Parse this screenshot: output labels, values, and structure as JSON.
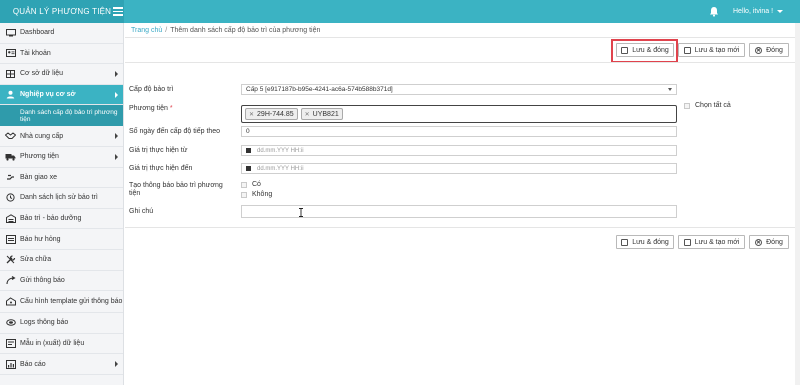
{
  "app": {
    "title": "QUẢN LÝ PHƯƠNG TIỆN"
  },
  "header": {
    "user_label": "Hello, itvina !"
  },
  "sidebar": {
    "items": [
      {
        "label": "Dashboard",
        "icon": "monitor-icon",
        "arrow": false
      },
      {
        "label": "Tài khoản",
        "icon": "user-card-icon",
        "arrow": false
      },
      {
        "label": "Cơ sở dữ liệu",
        "icon": "table-icon",
        "arrow": true
      },
      {
        "label": "Nghiệp vụ cơ sở",
        "icon": "user-icon",
        "arrow": true,
        "active": true
      },
      {
        "label": "Danh sách cấp độ bảo trì phương tiện",
        "sub": true
      },
      {
        "label": "Nhà cung cấp",
        "icon": "handshake-icon",
        "arrow": true
      },
      {
        "label": "Phương tiện",
        "icon": "truck-icon",
        "arrow": true
      },
      {
        "label": "Bàn giao xe",
        "icon": "handover-icon",
        "arrow": false
      },
      {
        "label": "Danh sách lịch sử bảo trì",
        "icon": "history-icon",
        "arrow": false
      },
      {
        "label": "Bảo trì - bảo dưỡng",
        "icon": "garage-icon",
        "arrow": false
      },
      {
        "label": "Báo hư hỏng",
        "icon": "warning-car-icon",
        "arrow": false
      },
      {
        "label": "Sửa chữa",
        "icon": "wrench-icon",
        "arrow": false
      },
      {
        "label": "Gửi thông báo",
        "icon": "send-icon",
        "arrow": false
      },
      {
        "label": "Cấu hình template gửi thông báo",
        "icon": "template-icon",
        "arrow": false,
        "two": true
      },
      {
        "label": "Logs thông báo",
        "icon": "logs-icon",
        "arrow": false
      },
      {
        "label": "Mẫu in (xuất) dữ liệu",
        "icon": "print-icon",
        "arrow": false
      },
      {
        "label": "Báo cáo",
        "icon": "report-icon",
        "arrow": true
      }
    ]
  },
  "breadcrumb": {
    "home": "Trang chủ",
    "separator": "/",
    "current": "Thêm danh sách cấp độ bảo trì của phương tiện"
  },
  "buttons": {
    "save_close": "Lưu & đóng",
    "save_new": "Lưu & tạo mới",
    "close": "Đóng"
  },
  "form": {
    "maintenance_level": {
      "label": "Cấp độ bảo trì",
      "value": "Cấp 5 [e917187b-b95e-4241-ac6a-574b588b371d]"
    },
    "vehicle": {
      "label": "Phương tiện",
      "required": "*",
      "tags": [
        "29H-744.85",
        "UYB821"
      ],
      "select_all": "Chọn tất cả"
    },
    "days_to_next": {
      "label": "Số ngày đến cấp độ tiếp theo",
      "value": "0"
    },
    "valid_from": {
      "label": "Giá trị thực hiện từ",
      "placeholder": "dd.mm.YYY HH:ii"
    },
    "valid_to": {
      "label": "Giá trị thực hiện đến",
      "placeholder": "dd.mm.YYY HH:ii"
    },
    "create_notice": {
      "label_line1": "Tạo thông báo bảo trì phương",
      "label_line2": "tiện",
      "yes": "Có",
      "no": "Không"
    },
    "note": {
      "label": "Ghi chú",
      "value": ""
    }
  },
  "colors": {
    "header": "#3bb3c3",
    "brand": "#2fa3b4",
    "active": "#3bb3c3",
    "highlight": "#e0434d",
    "link": "#3aa9c6"
  }
}
